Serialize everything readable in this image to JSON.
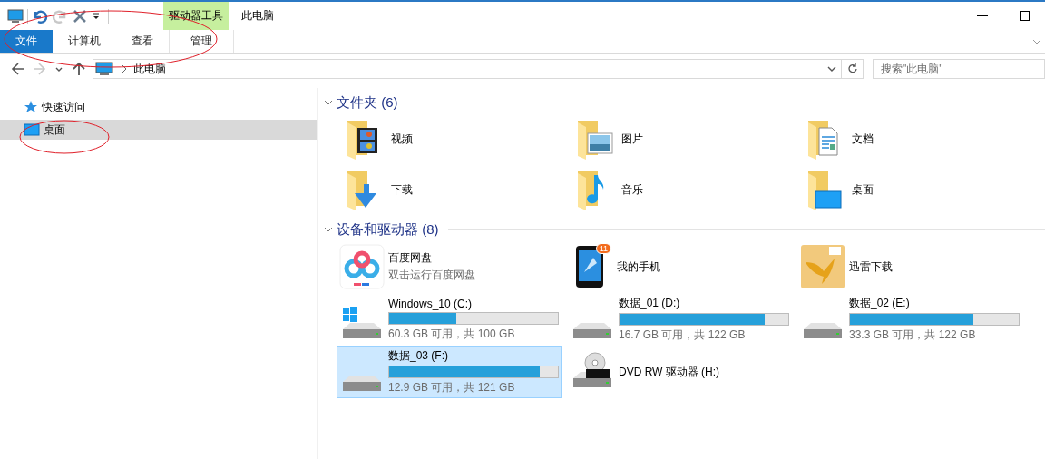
{
  "window": {
    "title": "此电脑",
    "contextual_group": "驱动器工具"
  },
  "quick_access_toolbar": [
    {
      "kind": "properties",
      "disabled": false
    },
    {
      "kind": "undo",
      "disabled": false
    },
    {
      "kind": "redo",
      "disabled": true
    },
    {
      "kind": "delete",
      "disabled": false
    },
    {
      "kind": "customize",
      "disabled": false
    }
  ],
  "ribbon_tabs": [
    {
      "label": "文件",
      "kind": "file"
    },
    {
      "label": "计算机",
      "kind": "tab"
    },
    {
      "label": "查看",
      "kind": "tab"
    },
    {
      "label": "管理",
      "kind": "contextual"
    }
  ],
  "nav_buttons": [
    {
      "kind": "back",
      "disabled": false
    },
    {
      "kind": "forward",
      "disabled": true
    },
    {
      "kind": "recent",
      "disabled": false
    },
    {
      "kind": "up",
      "disabled": false
    }
  ],
  "address": {
    "path": "此电脑"
  },
  "search": {
    "placeholder": "搜索\"此电脑\""
  },
  "sidebar": {
    "items": [
      {
        "label": "快速访问",
        "kind": "quick",
        "selected": false
      },
      {
        "label": "桌面",
        "kind": "desktop",
        "selected": true
      }
    ]
  },
  "groups": [
    {
      "title": "文件夹 (6)",
      "expanded": true,
      "items": [
        {
          "kind": "video",
          "name": "视频"
        },
        {
          "kind": "pictures",
          "name": "图片"
        },
        {
          "kind": "documents",
          "name": "文档"
        },
        {
          "kind": "downloads",
          "name": "下载"
        },
        {
          "kind": "music",
          "name": "音乐"
        },
        {
          "kind": "desktop",
          "name": "桌面"
        }
      ]
    },
    {
      "title": "设备和驱动器 (8)",
      "expanded": true,
      "items": [
        {
          "kind": "cloud_app",
          "name": "百度网盘",
          "subtitle": "双击运行百度网盘",
          "selected": false
        },
        {
          "kind": "phone",
          "name": "我的手机",
          "badge": "11",
          "selected": false
        },
        {
          "kind": "download_app",
          "name": "迅雷下载",
          "selected": false
        },
        {
          "kind": "system_drive",
          "name": "Windows_10 (C:)",
          "level": 0.4,
          "free": "60.3 GB 可用，共 100 GB",
          "selected": false
        },
        {
          "kind": "drive",
          "name": "数据_01 (D:)",
          "level": 0.86,
          "free": "16.7 GB 可用，共 122 GB",
          "selected": false
        },
        {
          "kind": "drive",
          "name": "数据_02 (E:)",
          "level": 0.73,
          "free": "33.3 GB 可用，共 122 GB",
          "selected": false
        },
        {
          "kind": "drive",
          "name": "数据_03 (F:)",
          "level": 0.89,
          "free": "12.9 GB 可用，共 121 GB",
          "selected": true
        },
        {
          "kind": "dvd",
          "name": "DVD RW 驱动器 (H:)",
          "selected": false
        }
      ]
    }
  ],
  "annotations": {
    "ribbon_circled": true,
    "sidebar_item_circled": true
  }
}
